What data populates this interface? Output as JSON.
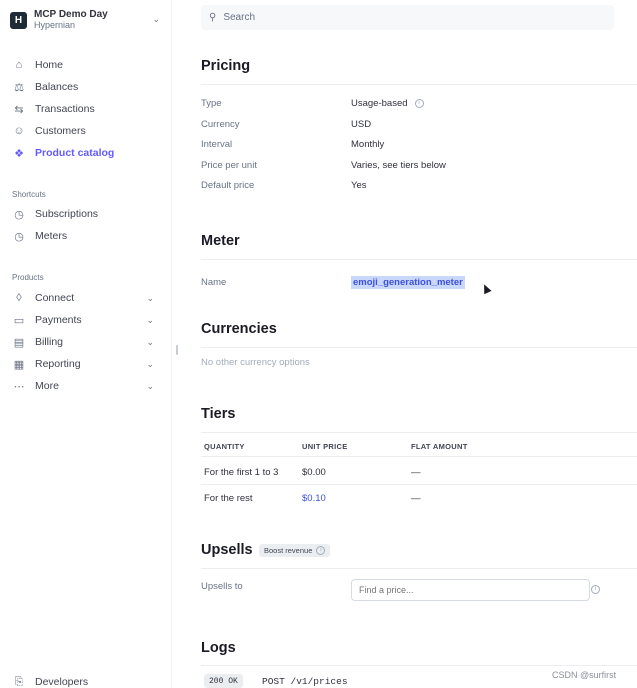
{
  "account": {
    "logo_letter": "H",
    "name": "MCP Demo Day",
    "subtitle": "Hypernian"
  },
  "sidebar": {
    "main_items": [
      {
        "label": "Home",
        "icon": "home-icon"
      },
      {
        "label": "Balances",
        "icon": "balances-icon"
      },
      {
        "label": "Transactions",
        "icon": "transactions-icon"
      },
      {
        "label": "Customers",
        "icon": "customers-icon"
      },
      {
        "label": "Product catalog",
        "icon": "product-catalog-icon",
        "active": true
      }
    ],
    "shortcuts_label": "Shortcuts",
    "shortcuts": [
      {
        "label": "Subscriptions",
        "icon": "clock-icon"
      },
      {
        "label": "Meters",
        "icon": "clock-icon"
      }
    ],
    "products_label": "Products",
    "products": [
      {
        "label": "Connect",
        "icon": "connect-icon"
      },
      {
        "label": "Payments",
        "icon": "payments-icon"
      },
      {
        "label": "Billing",
        "icon": "billing-icon"
      },
      {
        "label": "Reporting",
        "icon": "reporting-icon"
      },
      {
        "label": "More",
        "icon": "more-icon"
      }
    ],
    "developers_label": "Developers"
  },
  "search": {
    "placeholder": "Search"
  },
  "pricing": {
    "title": "Pricing",
    "rows": [
      {
        "label": "Type",
        "value": "Usage-based"
      },
      {
        "label": "Currency",
        "value": "USD"
      },
      {
        "label": "Interval",
        "value": "Monthly"
      },
      {
        "label": "Price per unit",
        "value": "Varies, see tiers below"
      },
      {
        "label": "Default price",
        "value": "Yes"
      }
    ]
  },
  "meter": {
    "title": "Meter",
    "name_label": "Name",
    "name_value": "emoji_generation_meter"
  },
  "currencies": {
    "title": "Currencies",
    "empty_text": "No other currency options"
  },
  "tiers": {
    "title": "Tiers",
    "headers": [
      "QUANTITY",
      "UNIT PRICE",
      "FLAT AMOUNT"
    ],
    "rows": [
      {
        "quantity": "For the first 1 to 3",
        "unit_price": "$0.00",
        "flat_amount": "—"
      },
      {
        "quantity": "For the rest",
        "unit_price": "$0.10",
        "flat_amount": "—"
      }
    ]
  },
  "upsells": {
    "title": "Upsells",
    "badge": "Boost revenue",
    "label": "Upsells to",
    "input_placeholder": "Find a price..."
  },
  "logs": {
    "title": "Logs",
    "status": "200 OK",
    "request": "POST /v1/prices"
  },
  "watermark": "CSDN @surfirst"
}
